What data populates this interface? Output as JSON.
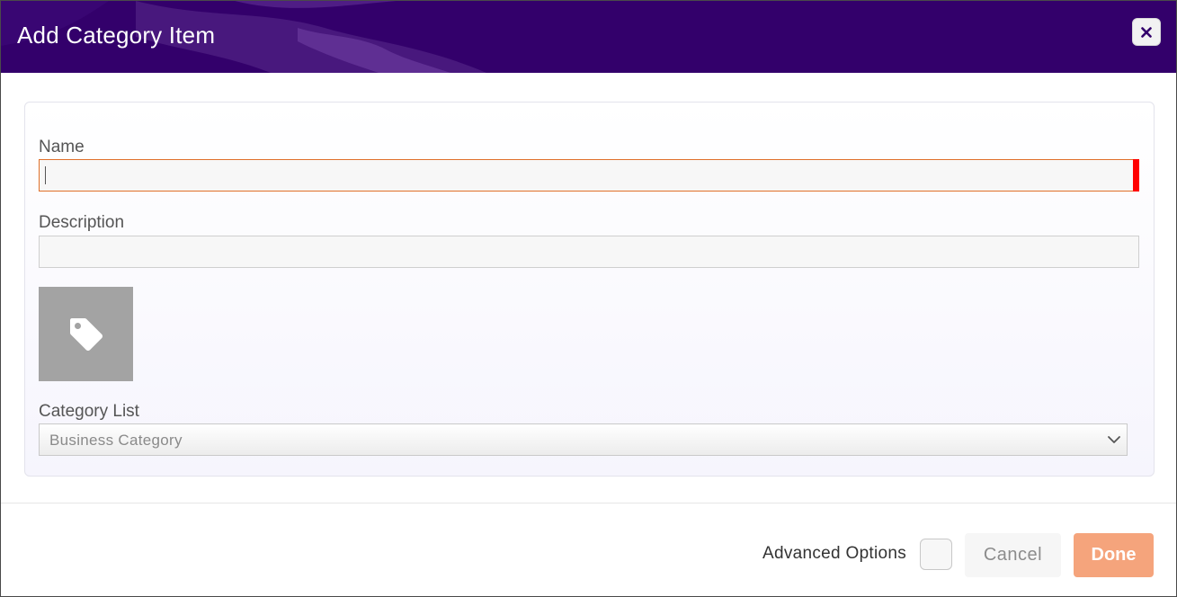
{
  "dialog": {
    "title": "Add Category Item"
  },
  "form": {
    "name": {
      "label": "Name",
      "value": ""
    },
    "description": {
      "label": "Description",
      "value": ""
    },
    "icon": "tag-icon",
    "category_list": {
      "label": "Category List",
      "selected": "Business Category"
    }
  },
  "footer": {
    "advanced_options_label": "Advanced Options",
    "advanced_options_checked": false,
    "cancel_label": "Cancel",
    "done_label": "Done"
  },
  "colors": {
    "header_bg": "#33006b",
    "required_marker": "#ff0000",
    "name_border": "#e0702a",
    "done_bg": "#f5a47c",
    "icon_tile_bg": "#a3a3a3"
  }
}
